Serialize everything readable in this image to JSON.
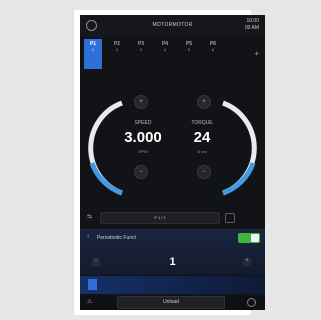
{
  "window": {
    "title": "MOTORMOTOR",
    "time_line1": "10:00",
    "time_line2": "00 AM"
  },
  "programs": [
    {
      "label": "P1",
      "sub": "1",
      "active": true
    },
    {
      "label": "P2",
      "sub": "2",
      "active": false
    },
    {
      "label": "P3",
      "sub": "3",
      "active": false
    },
    {
      "label": "P4",
      "sub": "4",
      "active": false
    },
    {
      "label": "P5",
      "sub": "5",
      "active": false
    },
    {
      "label": "P6",
      "sub": "6",
      "active": false
    }
  ],
  "add_program": "+",
  "speed": {
    "label": "SPEED",
    "value": "3.000",
    "unit": "RPM"
  },
  "torque": {
    "label": "TORQUE",
    "value": "24",
    "unit": "N·cm"
  },
  "step": {
    "label": "P 1 / 1"
  },
  "function": {
    "title": "Periodontic Funct",
    "value": "1",
    "enabled": true
  },
  "bottom": {
    "unload_label": "Unload"
  },
  "colors": {
    "accent": "#2f6fd8",
    "toggle_on": "#3fb53f",
    "background": "#121316"
  }
}
